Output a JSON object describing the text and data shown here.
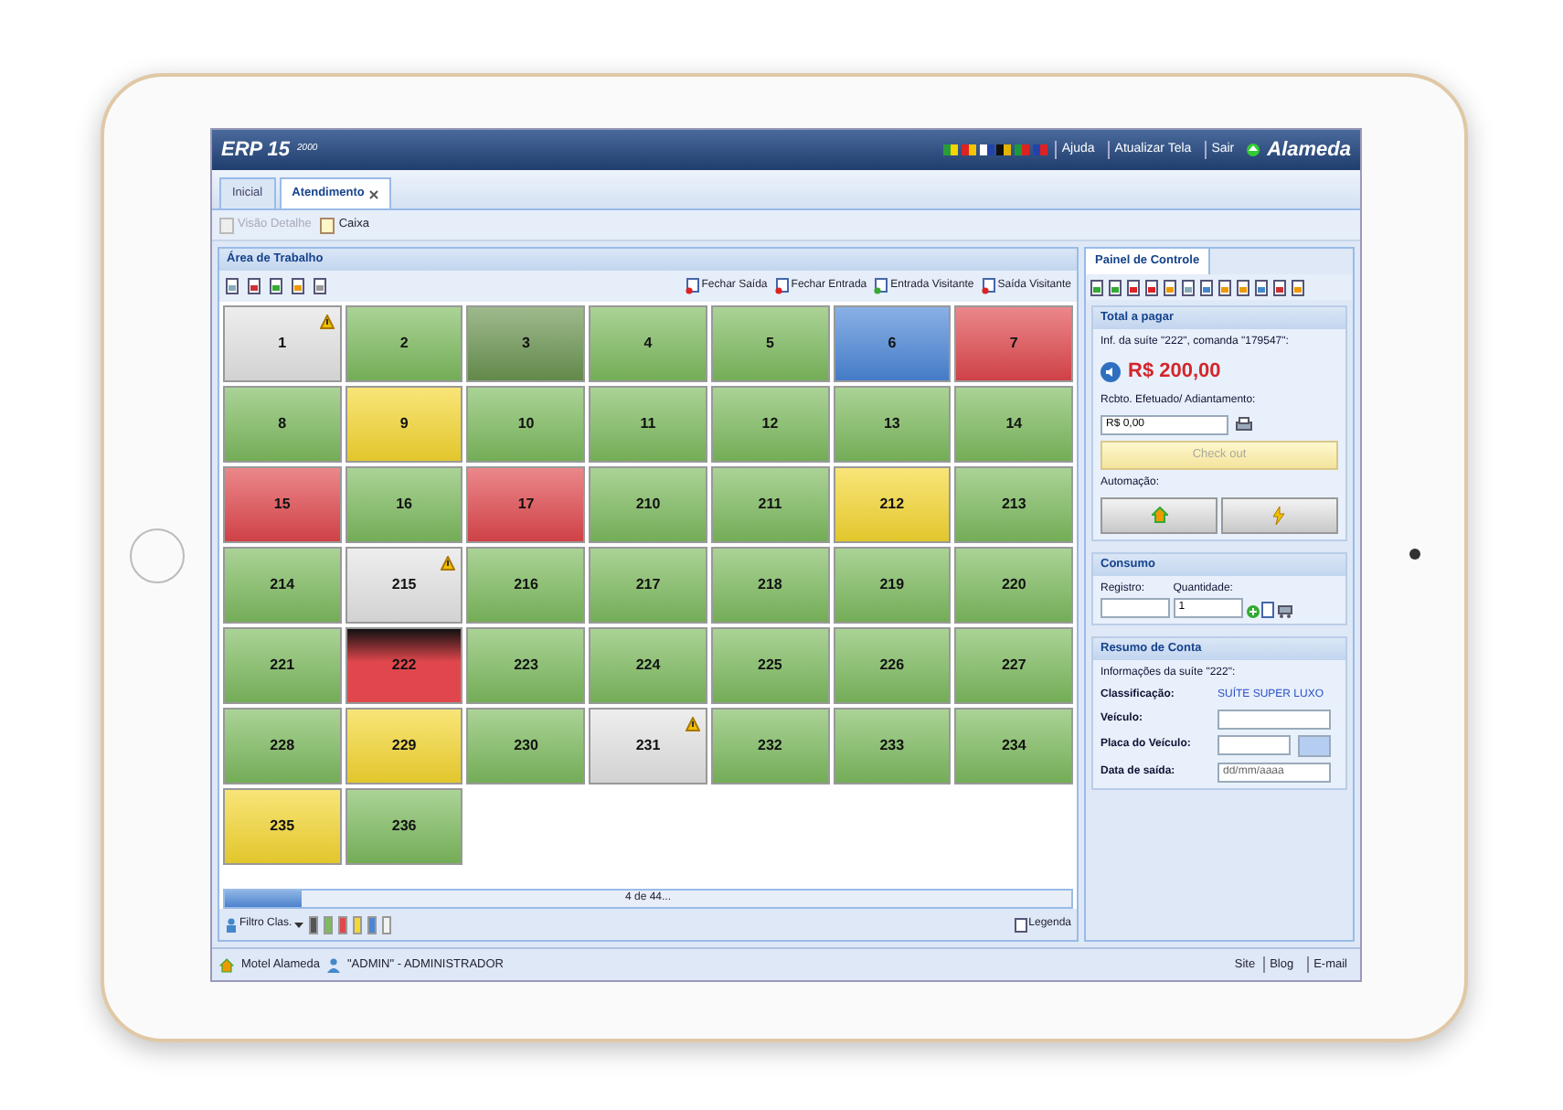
{
  "header": {
    "title": "ERP 15",
    "version": "2000",
    "links": [
      "Ajuda",
      "Atualizar Tela",
      "Sair"
    ],
    "logo": "Alameda"
  },
  "tabs": [
    {
      "label": "Inicial",
      "selected": false,
      "closable": false
    },
    {
      "label": "Atendimento",
      "selected": true,
      "closable": true
    }
  ],
  "toolbar": [
    {
      "label": "Visão Detalhe",
      "disabled": true
    },
    {
      "label": "Caixa",
      "disabled": false
    }
  ],
  "work_area": {
    "title": "Área de Trabalho",
    "actions": [
      "Fechar Saída",
      "Fechar Entrada",
      "Entrada Visitante",
      "Saída Visitante"
    ],
    "rooms": [
      {
        "number": "1",
        "color": "#e4e4e4",
        "alert": true,
        "selected": false
      },
      {
        "number": "2",
        "color": "#7dbb5e",
        "alert": false,
        "selected": false
      },
      {
        "number": "3",
        "color": "#6a9450",
        "alert": false,
        "selected": false
      },
      {
        "number": "4",
        "color": "#7dbb5e",
        "alert": false,
        "selected": false
      },
      {
        "number": "5",
        "color": "#7dbb5e",
        "alert": false,
        "selected": false
      },
      {
        "number": "6",
        "color": "#4a86d8",
        "alert": false,
        "selected": false
      },
      {
        "number": "7",
        "color": "#e0474c",
        "alert": false,
        "selected": false
      },
      {
        "number": "8",
        "color": "#7dbb5e",
        "alert": false,
        "selected": false
      },
      {
        "number": "9",
        "color": "#f5d730",
        "alert": false,
        "selected": false
      },
      {
        "number": "10",
        "color": "#7dbb5e",
        "alert": false,
        "selected": false
      },
      {
        "number": "11",
        "color": "#7dbb5e",
        "alert": false,
        "selected": false
      },
      {
        "number": "12",
        "color": "#7dbb5e",
        "alert": false,
        "selected": false
      },
      {
        "number": "13",
        "color": "#7dbb5e",
        "alert": false,
        "selected": false
      },
      {
        "number": "14",
        "color": "#7dbb5e",
        "alert": false,
        "selected": false
      },
      {
        "number": "15",
        "color": "#e0474c",
        "alert": false,
        "selected": false
      },
      {
        "number": "16",
        "color": "#7dbb5e",
        "alert": false,
        "selected": false
      },
      {
        "number": "17",
        "color": "#e0474c",
        "alert": false,
        "selected": false
      },
      {
        "number": "210",
        "color": "#7dbb5e",
        "alert": false,
        "selected": false
      },
      {
        "number": "211",
        "color": "#7dbb5e",
        "alert": false,
        "selected": false
      },
      {
        "number": "212",
        "color": "#f5d730",
        "alert": false,
        "selected": false
      },
      {
        "number": "213",
        "color": "#7dbb5e",
        "alert": false,
        "selected": false
      },
      {
        "number": "214",
        "color": "#7dbb5e",
        "alert": false,
        "selected": false
      },
      {
        "number": "215",
        "color": "#e4e4e4",
        "alert": true,
        "selected": false
      },
      {
        "number": "216",
        "color": "#7dbb5e",
        "alert": false,
        "selected": false
      },
      {
        "number": "217",
        "color": "#7dbb5e",
        "alert": false,
        "selected": false
      },
      {
        "number": "218",
        "color": "#7dbb5e",
        "alert": false,
        "selected": false
      },
      {
        "number": "219",
        "color": "#7dbb5e",
        "alert": false,
        "selected": false
      },
      {
        "number": "220",
        "color": "#7dbb5e",
        "alert": false,
        "selected": false
      },
      {
        "number": "221",
        "color": "#7dbb5e",
        "alert": false,
        "selected": false
      },
      {
        "number": "222",
        "color": "#e0474c",
        "alert": false,
        "selected": true
      },
      {
        "number": "223",
        "color": "#7dbb5e",
        "alert": false,
        "selected": false
      },
      {
        "number": "224",
        "color": "#7dbb5e",
        "alert": false,
        "selected": false
      },
      {
        "number": "225",
        "color": "#7dbb5e",
        "alert": false,
        "selected": false
      },
      {
        "number": "226",
        "color": "#7dbb5e",
        "alert": false,
        "selected": false
      },
      {
        "number": "227",
        "color": "#7dbb5e",
        "alert": false,
        "selected": false
      },
      {
        "number": "228",
        "color": "#7dbb5e",
        "alert": false,
        "selected": false
      },
      {
        "number": "229",
        "color": "#f5d730",
        "alert": false,
        "selected": false
      },
      {
        "number": "230",
        "color": "#7dbb5e",
        "alert": false,
        "selected": false
      },
      {
        "number": "231",
        "color": "#e4e4e4",
        "alert": true,
        "selected": false
      },
      {
        "number": "232",
        "color": "#7dbb5e",
        "alert": false,
        "selected": false
      },
      {
        "number": "233",
        "color": "#7dbb5e",
        "alert": false,
        "selected": false
      },
      {
        "number": "234",
        "color": "#7dbb5e",
        "alert": false,
        "selected": false
      },
      {
        "number": "235",
        "color": "#f5d730",
        "alert": false,
        "selected": false
      },
      {
        "number": "236",
        "color": "#7dbb5e",
        "alert": false,
        "selected": false
      }
    ],
    "progress": {
      "level": 0.09,
      "label": "4 de 44..."
    },
    "filter_label": "Filtro Clas.",
    "swatches": [
      {
        "color": "#555555"
      },
      {
        "color": "#7dbb5e"
      },
      {
        "color": "#e0474c"
      },
      {
        "color": "#f5d730"
      },
      {
        "color": "#4a86d8"
      },
      {
        "color": "#f2f2f2"
      }
    ],
    "legend_label": "Legenda"
  },
  "control_panel": {
    "tab": "Painel de Controle",
    "total": {
      "title": "Total a pagar",
      "info": "Inf. da suíte \"222\", comanda \"179547\":",
      "amount": "R$ 200,00",
      "payment_label": "Rcbto. Efetuado/ Adiantamento:",
      "payment_value": "R$ 0,00",
      "checkout": {
        "label": "Check out",
        "disabled": true
      },
      "automation_label": "Automação:"
    },
    "consumption": {
      "title": "Consumo",
      "registro_label": "Registro:",
      "quantidade_label": "Quantidade:",
      "quantidade_value": "1"
    },
    "account": {
      "title": "Resumo de Conta",
      "info": "Informações da suíte \"222\":",
      "fields": [
        {
          "label": "Classificação:",
          "kind": "text",
          "value": "SUÍTE SUPER LUXO"
        },
        {
          "label": "Veículo:",
          "kind": "input"
        },
        {
          "label": "Placa do Veículo:",
          "kind": "input-button"
        },
        {
          "label": "Data de saída:",
          "kind": "input",
          "placeholder": "dd/mm/aaaa"
        }
      ]
    }
  },
  "footer": {
    "company": "Motel Alameda",
    "user": "\"ADMIN\" - ADMINISTRADOR",
    "links": [
      "Site",
      "Blog",
      "E-mail"
    ]
  }
}
